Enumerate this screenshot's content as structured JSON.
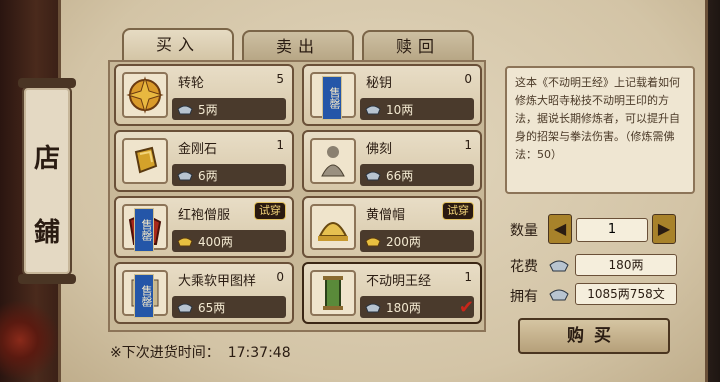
{
  "shop_title": [
    "店",
    "鋪"
  ],
  "tabs": [
    {
      "label": "买入",
      "active": true
    },
    {
      "label": "卖出",
      "active": false
    },
    {
      "label": "赎回",
      "active": false
    }
  ],
  "items": [
    {
      "name": "转轮",
      "qty": "5",
      "price": "5两",
      "icon": "golden-wheel-icon",
      "sell_badge": null,
      "try_badge": null,
      "selected": false
    },
    {
      "name": "秘钥",
      "qty": "0",
      "price": "10两",
      "icon": "secret-key-icon",
      "sell_badge": "售罄",
      "try_badge": null,
      "selected": false
    },
    {
      "name": "金刚石",
      "qty": "1",
      "price": "6两",
      "icon": "diamond-stone-icon",
      "sell_badge": null,
      "try_badge": null,
      "selected": false
    },
    {
      "name": "佛刻",
      "qty": "1",
      "price": "66两",
      "icon": "buddha-statue-icon",
      "sell_badge": null,
      "try_badge": null,
      "selected": false
    },
    {
      "name": "红袍僧服",
      "qty": "",
      "price": "400两",
      "icon": "red-robe-icon",
      "sell_badge": "售罄",
      "try_badge": "试穿",
      "selected": false
    },
    {
      "name": "黄僧帽",
      "qty": "",
      "price": "200两",
      "icon": "yellow-hat-icon",
      "sell_badge": null,
      "try_badge": "试穿",
      "selected": false
    },
    {
      "name": "大乘软甲图样",
      "qty": "0",
      "price": "65两",
      "icon": "armor-pattern-icon",
      "sell_badge": "售罄",
      "try_badge": null,
      "selected": false
    },
    {
      "name": "不动明王经",
      "qty": "1",
      "price": "180两",
      "icon": "scripture-scroll-icon",
      "sell_badge": null,
      "try_badge": null,
      "selected": true
    }
  ],
  "restock_label": "※下次进货时间：",
  "restock_time": "17:37:48",
  "description": "这本《不动明王经》上记载着如何修炼大昭寺秘技不动明王印的方法，据说长期修炼者，可以提升自身的招架与拳法伤害。（修炼需佛法：50）",
  "quantity_label": "数量",
  "quantity_value": "1",
  "cost_label": "花费",
  "cost_value": "180两",
  "owned_label": "拥有",
  "owned_value": "1085两758文",
  "buy_label": "购买",
  "colors": {
    "accent": "#a8822a",
    "panel": "#d9ccb2",
    "check": "#c8261a"
  }
}
